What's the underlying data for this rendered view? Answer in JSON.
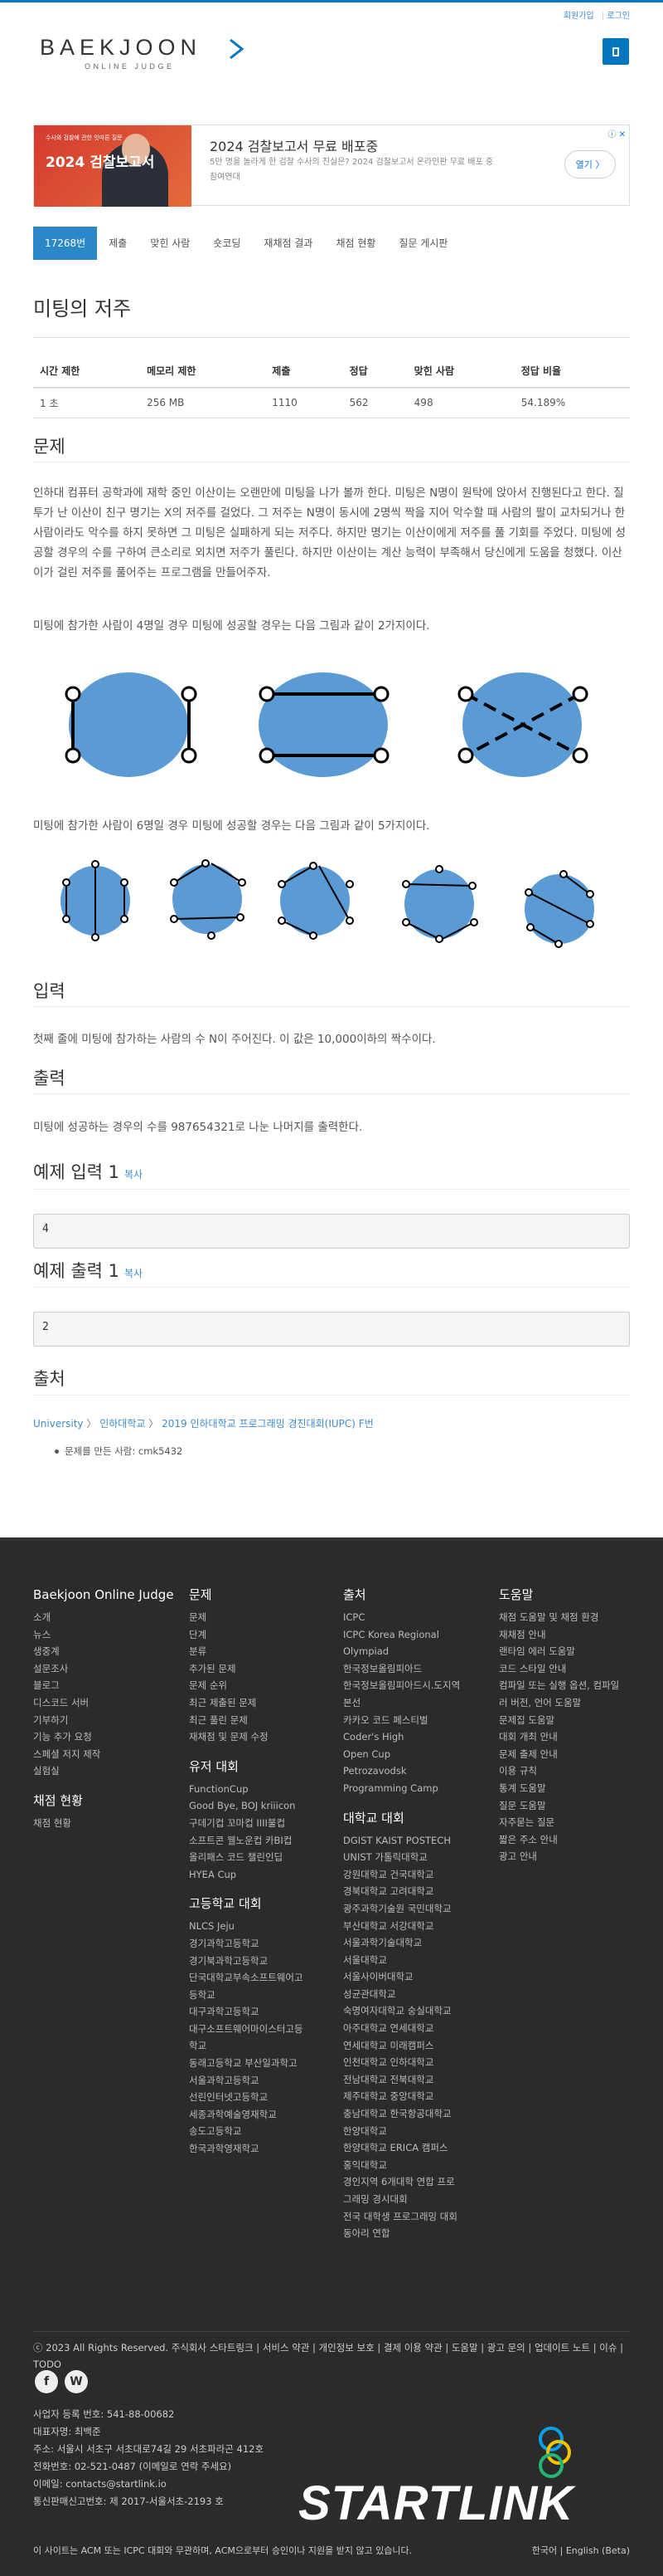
{
  "header": {
    "links": [
      "회원가입",
      "로그인"
    ],
    "logo_text": "BAEKJOON",
    "logo_sub": "ONLINE JUDGE",
    "menu_icon": "menu-icon"
  },
  "ad": {
    "image_small": "수사와 검찰에 관한 잇따른 질문",
    "image_title": "2024 검찰보고서",
    "title": "2024 검찰보고서 무료 배포중",
    "desc": "5만 명을 놀라게 한 검찰 수사의 진실은? 2024 검찰보고서 온라인판 무료 배포 중",
    "source": "참여연대",
    "cta": "열기"
  },
  "tabs": [
    "17268번",
    "제출",
    "맞힌 사람",
    "숏코딩",
    "재채점 결과",
    "채점 현황",
    "질문 게시판"
  ],
  "problem": {
    "title": "미팅의 저주",
    "table_headers": [
      "시간 제한",
      "메모리 제한",
      "제출",
      "정답",
      "맞힌 사람",
      "정답 비율"
    ],
    "table_values": [
      "1 초",
      "256 MB",
      "1110",
      "562",
      "498",
      "54.189%"
    ],
    "sec_problem": "문제",
    "desc1": "인하대 컴퓨터 공학과에 재학 중인 이산이는 오랜만에 미팅을 나가 볼까 한다. 미팅은 N명이 원탁에 앉아서 진행된다고 한다. 질투가 난 이산이 친구 명기는 X의 저주를 걸었다. 그 저주는 N명이 동시에 2명씩 짝을 지어 악수할 때 사람의 팔이 교차되거나 한 사람이라도 악수를 하지 못하면 그 미팅은 실패하게 되는 저주다. 하지만 명기는 이산이에게 저주를 풀 기회를 주었다. 미팅에 성공할 경우의 수를 구하여 큰소리로 외치면 저주가 풀린다. 하지만 이산이는 계산 능력이 부족해서 당신에게 도움을 청했다. 이산이가 걸린 저주를 풀어주는 프로그램을 만들어주자.",
    "desc2": "미팅에 참가한 사람이 4명일 경우 미팅에 성공할 경우는 다음 그림과 같이 2가지이다.",
    "desc3": "미팅에 참가한 사람이 6명일 경우 미팅에 성공할 경우는 다음 그림과 같이 5가지이다.",
    "sec_input": "입력",
    "input_text": "첫째 줄에 미팅에 참가하는 사람의 수 N이 주어진다. 이 값은 10,000이하의 짝수이다.",
    "sec_output": "출력",
    "output_text": "미팅에 성공하는 경우의 수를 987654321로 나눈 나머지를 출력한다.",
    "sample_in_title": "예제 입력 1",
    "sample_out_title": "예제 출력 1",
    "copy_label": "복사",
    "sample_in": "4",
    "sample_out": "2",
    "sec_source": "출처",
    "source_path": [
      "University",
      "인하대학교",
      "2019 인하대학교 프로그래밍 경진대회(IUPC) F번"
    ],
    "source_sep": "〉",
    "maker": "문제를 만든 사람: cmk5432"
  },
  "footer": {
    "col1_title": "Baekjoon Online Judge",
    "col1": [
      "소개",
      "뉴스",
      "생중계",
      "설문조사",
      "블로그",
      "디스코드 서버",
      "기부하기",
      "기능 추가 요청",
      "스페셜 저지 제작",
      "실험실"
    ],
    "col1b_title": "채점 현황",
    "col1b": [
      "채점 현황"
    ],
    "col2_title": "문제",
    "col2": [
      "문제",
      "단계",
      "분류",
      "추가된 문제",
      "문제 순위",
      "최근 제출된 문제",
      "최근 풀린 문제",
      "재채점 및 문제 수정"
    ],
    "col2b_title": "유저 대회",
    "col2b": [
      "FunctionCup",
      "Good Bye, BOJ kriiicon",
      "구데기컵 꼬마컵 IIII불컵",
      "소프트콘 웰노운컵 카BI컵",
      "올리패스 코드 챌린인딥",
      "HYEA Cup"
    ],
    "col2c_title": "고등학교 대회",
    "col2c": [
      "NLCS Jeju",
      "경기과학고등학교",
      "경기북과학고등학교",
      "단국대학교부속소프트웨어고",
      "등학교",
      "대구과학고등학교",
      "대구소프트웨어마이스터고등",
      "학교",
      "동래고등학교 부산일과학고",
      "서울과학고등학교",
      "선린인터넷고등학교",
      "세종과학예술영재학교",
      "송도고등학교",
      "한국과학영재학교"
    ],
    "col3_title": "출처",
    "col3": [
      "ICPC",
      "ICPC Korea Regional",
      "Olympiad",
      "한국정보올림피아드",
      "한국정보올림피아드시.도지역",
      "본선",
      "카카오 코드 페스티벌",
      "Coder's High",
      "Open Cup",
      "Petrozavodsk",
      "Programming Camp"
    ],
    "col3b_title": "대학교 대회",
    "col3b": [
      "DGIST KAIST POSTECH",
      "UNIST 가톨릭대학교",
      "강원대학교 건국대학교",
      "경북대학교 고려대학교",
      "광주과학기술원 국민대학교",
      "부산대학교 서강대학교",
      "서울과학기술대학교",
      "서울대학교",
      "서울사이버대학교",
      "성균관대학교",
      "숙명여자대학교 숭실대학교",
      "아주대학교 연세대학교",
      "연세대학교 미래캠퍼스",
      "인천대학교 인하대학교",
      "전남대학교 전북대학교",
      "제주대학교 중앙대학교",
      "충남대학교 한국항공대학교",
      "한양대학교",
      "한양대학교 ERICA 캠퍼스",
      "홍익대학교",
      "경인지역 6개대학 연합 프로",
      "그래밍 경시대회",
      "전국 대학생 프로그래밍 대회",
      "동아리 연합"
    ],
    "col4_title": "도움말",
    "col4": [
      "채점 도움말 및 채점 환경",
      "재채점 안내",
      "랜타임 에러 도움말",
      "코드 스타일 안내",
      "컴파일 또는 실행 옵션, 컴파일",
      "러 버전, 언어 도움말",
      "문제집 도움말",
      "대회 개최 안내",
      "문제 출제 안내",
      "이용 규칙",
      "통계 도움말",
      "질문 도움말",
      "자주묻는 질문",
      "짧은 주소 안내",
      "광고 안내"
    ],
    "bottom_links": "ⓒ 2023 All Rights Reserved. 주식회사 스타트링크 | 서비스 약관 | 개인정보 보호 | 결제 이용 약관 | 도움말 | 광고 문의 | 업데이트 노트 | 이슈 | TODO",
    "social": [
      "f",
      "W"
    ],
    "company": [
      "사업자 등록 번호: 541-88-00682",
      "대표자명: 최백준",
      "주소: 서울시 서초구 서초대로74길 29 서초파라곤 412호",
      "전화번호: 02-521-0487 (이메일로 연락 주세요)",
      "이메일: contacts@startlink.io",
      "통신판매신고번호: 제 2017-서울서초-2193 호"
    ],
    "brand": "STARTLINK",
    "notice": "이 사이트는 ACM 또는 ICPC 대회와 무관하며, ACM으로부터 승인이나 지원을 받지 않고 있습니다.",
    "lang": "한국어 | English (Beta)"
  },
  "colors": {
    "accent": "#0076c0",
    "tab_active": "#2a88c8",
    "link": "#428bca",
    "footer_bg": "#2b2b2b",
    "circle_fill": "#5b9bd5"
  }
}
